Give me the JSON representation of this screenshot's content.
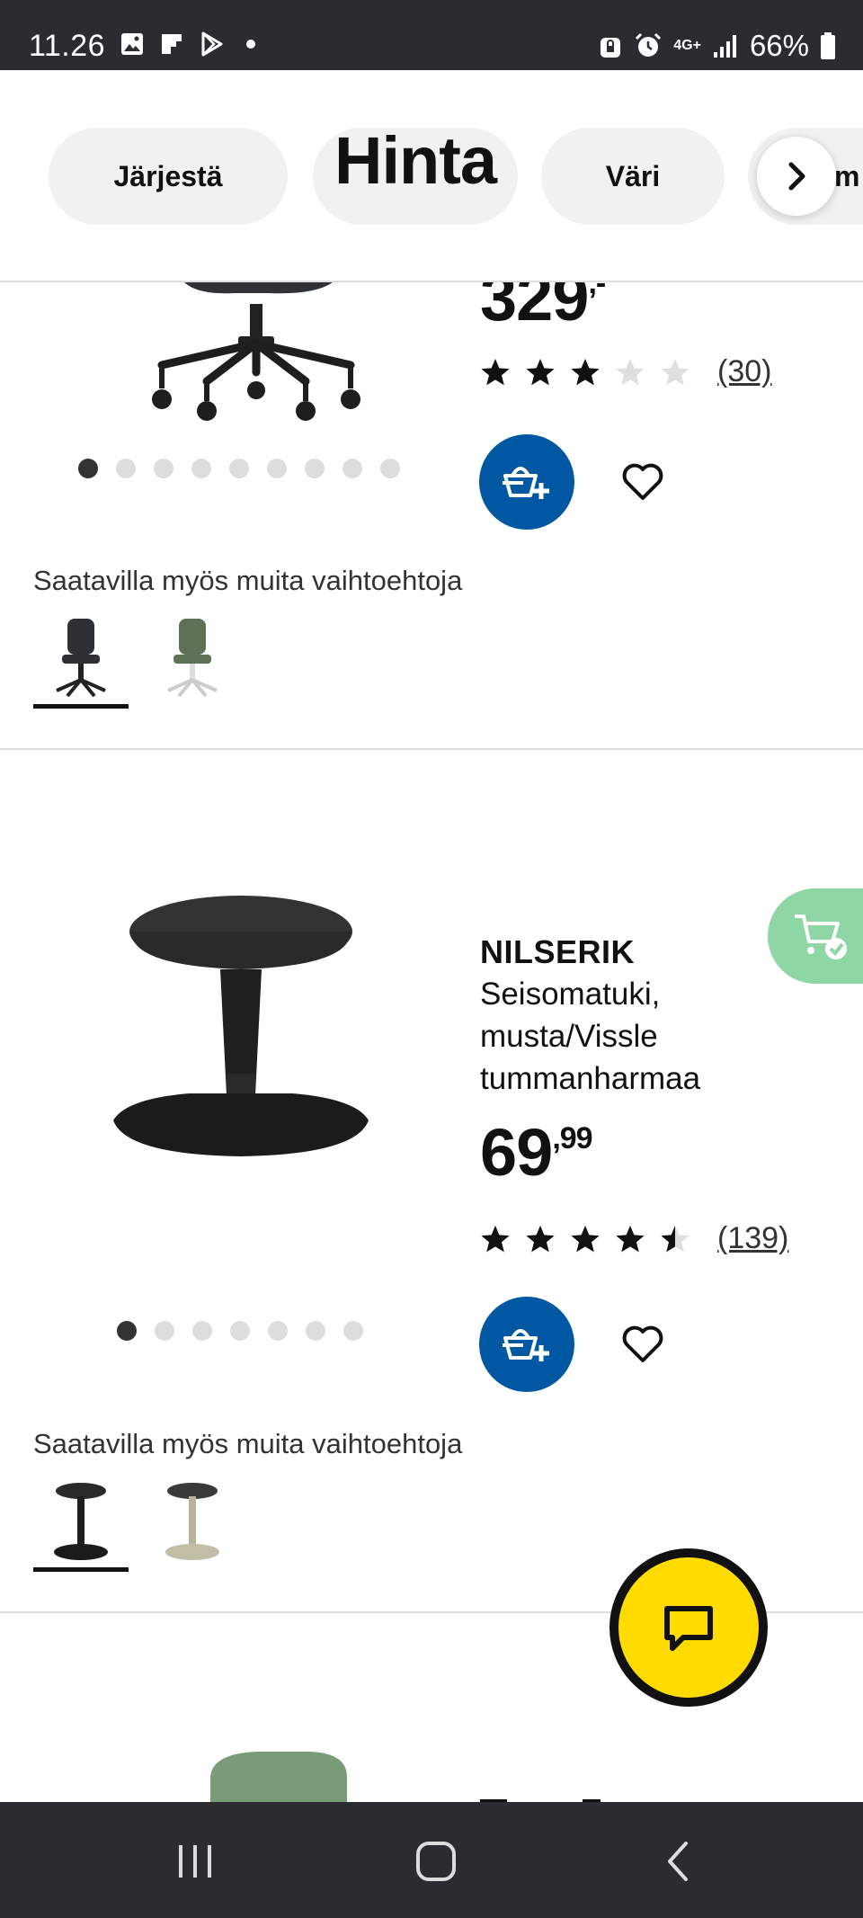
{
  "status_bar": {
    "time": "11.26",
    "network": "4G+",
    "battery": "66%",
    "icons": [
      "gallery-icon",
      "flipboard-icon",
      "play-store-icon",
      "dot-icon",
      "vpn-lock-icon",
      "alarm-icon",
      "signal-icon",
      "battery-icon"
    ]
  },
  "filters": {
    "sort_label": "Järjestä",
    "price_label": "Hinta",
    "color_label": "Väri",
    "more_label": "m"
  },
  "products": [
    {
      "price_int": "329",
      "price_dec": ",-",
      "rating": 3,
      "rating_max": 5,
      "review_count": "(30)",
      "image_dots": 9,
      "active_dot": 0,
      "variants_label": "Saatavilla myös muita vaihtoehtoja",
      "variants": [
        "black-office-chair",
        "green-office-chair"
      ]
    },
    {
      "brand": "NILSERIK",
      "desc": "Seisomatuki, musta/Vissle tummanharmaa",
      "price_int": "69",
      "price_dec": ",99",
      "rating": 4.5,
      "rating_max": 5,
      "review_count": "(139)",
      "image_dots": 7,
      "active_dot": 0,
      "in_cart": true,
      "variants_label": "Saatavilla myös muita vaihtoehtoja",
      "variants": [
        "black-stool",
        "beige-stool"
      ]
    }
  ],
  "colors": {
    "brand_blue": "#0058a3",
    "chat_yellow": "#ffdb00",
    "in_cart_green": "#8fd6a5",
    "system_bar": "#2b2c30"
  }
}
